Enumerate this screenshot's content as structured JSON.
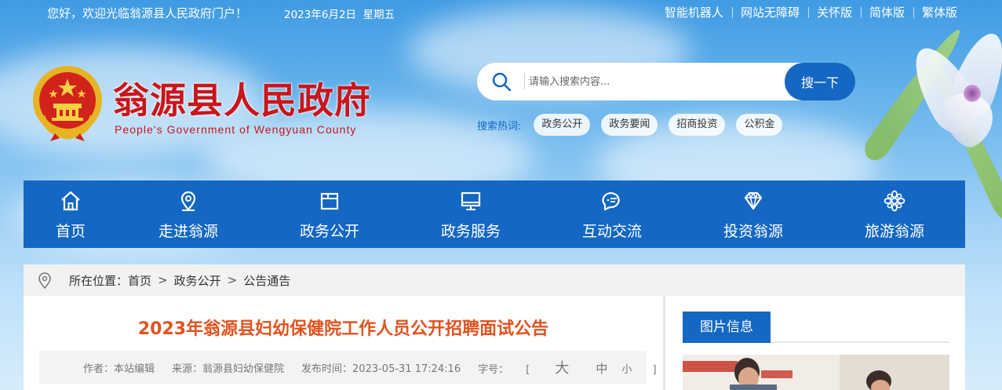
{
  "topbar": {
    "welcome": "您好，欢迎光临翁源县人民政府门户！",
    "date": "2023年6月2日",
    "weekday": "星期五",
    "links": [
      "智能机器人",
      "网站无障碍",
      "关怀版",
      "简体版",
      "繁体版"
    ]
  },
  "header": {
    "title": "翁源县人民政府",
    "subtitle": "People's Government of Wengyuan County"
  },
  "search": {
    "placeholder": "请输入搜索内容...",
    "button_label": "搜一下",
    "hot_label": "搜索热词:",
    "hot_words": [
      "政务公开",
      "政务要闻",
      "招商投资",
      "公积金"
    ]
  },
  "nav": {
    "items": [
      {
        "label": "首页",
        "icon": "home-icon"
      },
      {
        "label": "走进翁源",
        "icon": "location-pin-icon"
      },
      {
        "label": "政务公开",
        "icon": "folder-icon"
      },
      {
        "label": "政务服务",
        "icon": "monitor-icon"
      },
      {
        "label": "互动交流",
        "icon": "chat-icon"
      },
      {
        "label": "投资翁源",
        "icon": "diamond-icon"
      },
      {
        "label": "旅游翁源",
        "icon": "flower-icon"
      }
    ]
  },
  "breadcrumb": {
    "prefix": "所在位置：",
    "items": [
      "首页",
      "政务公开",
      "公告通告"
    ],
    "separator": ">"
  },
  "article": {
    "title": "2023年翁源县妇幼保健院工作人员公开招聘面试公告",
    "author": "作者：本站编辑",
    "source": "来源：翁源县妇幼保健院",
    "published": "发布时间：2023-05-31 17:24:16",
    "font_size_label": "字号：",
    "font_sizes": [
      "大",
      "中",
      "小"
    ],
    "bracket_open": "[",
    "bracket_close": "]"
  },
  "sidebar": {
    "section_title": "图片信息"
  },
  "colors": {
    "brand_blue": "#1467c2",
    "title_red": "#c8161d",
    "article_title_orange": "#e0531f"
  }
}
